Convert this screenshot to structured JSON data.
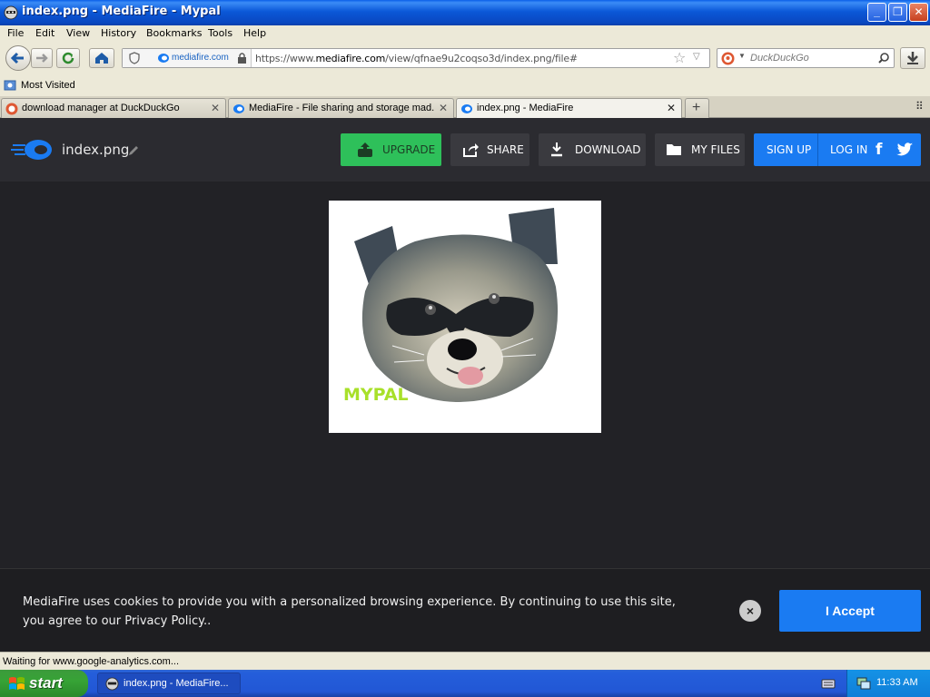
{
  "window": {
    "title": "index.png - MediaFire - Mypal"
  },
  "menu": [
    "File",
    "Edit",
    "View",
    "History",
    "Bookmarks",
    "Tools",
    "Help"
  ],
  "address": {
    "site_label": "mediafire.com",
    "url_prefix": "https://www.",
    "url_domain": "mediafire.com",
    "url_path": "/view/qfnae9u2coqso3d/index.png/file#"
  },
  "search": {
    "placeholder": "DuckDuckGo"
  },
  "bookmarks": {
    "most_visited": "Most Visited"
  },
  "tabs": [
    {
      "label": "download manager at DuckDuckGo"
    },
    {
      "label": "MediaFire - File sharing and storage mad..."
    },
    {
      "label": "index.png - MediaFire"
    }
  ],
  "mediafire": {
    "filename": "index.png",
    "buttons": {
      "upgrade": "UPGRADE",
      "share": "SHARE",
      "download": "DOWNLOAD",
      "my_files": "MY FILES",
      "sign_up": "SIGN UP",
      "log_in": "LOG IN"
    },
    "preview_caption": "MYPAL"
  },
  "cookie": {
    "text": "MediaFire uses cookies to provide you with a personalized browsing experience. By continuing to use this site, you agree to our Privacy Policy..",
    "accept": "I Accept"
  },
  "status": {
    "text": "Waiting for www.google-analytics.com..."
  },
  "taskbar": {
    "start": "start",
    "item": "index.png - MediaFire...",
    "clock": "11:33 AM"
  },
  "colors": {
    "upgrade_green": "#2ec05a",
    "mediafire_blue": "#1a7bf2",
    "page_bg": "#222226"
  }
}
